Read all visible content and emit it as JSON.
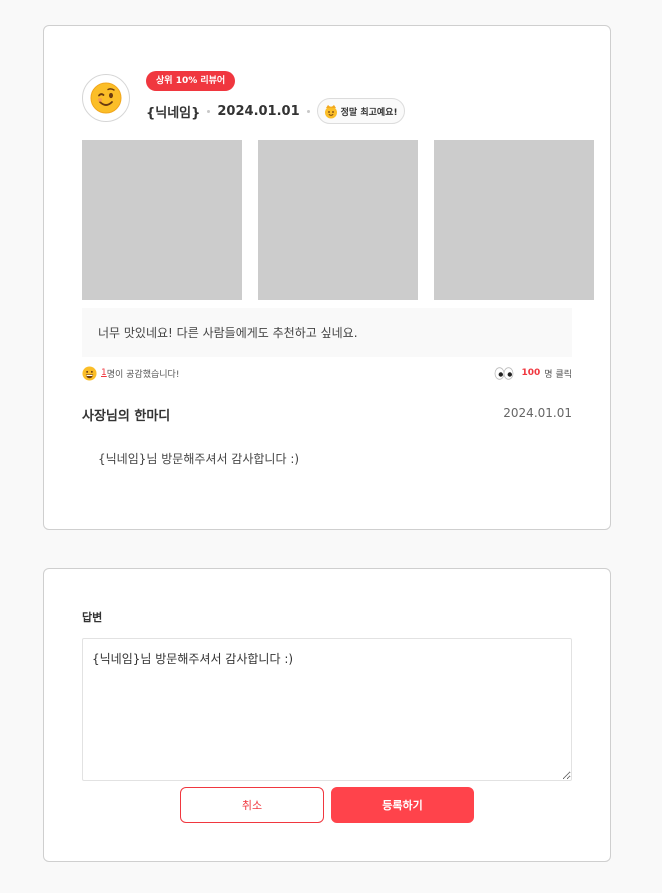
{
  "review": {
    "badge": "상위 10% 리뷰어",
    "nickname": "{닉네임}",
    "date": "2024.01.01",
    "rating_label": "정말 최고예요!",
    "avatar_icon": "winking-face-icon",
    "rating_icon": "crown-face-icon",
    "photos": [
      "",
      "",
      ""
    ],
    "text": "너무 맛있네요! 다른 사람들에게도 추천하고 싶네요.",
    "empathy_count": "1",
    "empathy_suffix": "명이 공감했습니다!",
    "click_count": "100",
    "click_suffix": "명 클릭"
  },
  "owner_reply": {
    "title": "사장님의 한마디",
    "date": "2024.01.01",
    "text": "{닉네임}님 방문해주셔서 감사합니다 :)"
  },
  "reply_form": {
    "label": "답변",
    "textarea_value": "{닉네임}님 방문해주셔서 감사합니다 :)",
    "cancel_label": "취소",
    "submit_label": "등록하기"
  },
  "colors": {
    "accent": "#f0373f",
    "submit": "#ff434b",
    "photo_placeholder": "#cccccc"
  }
}
